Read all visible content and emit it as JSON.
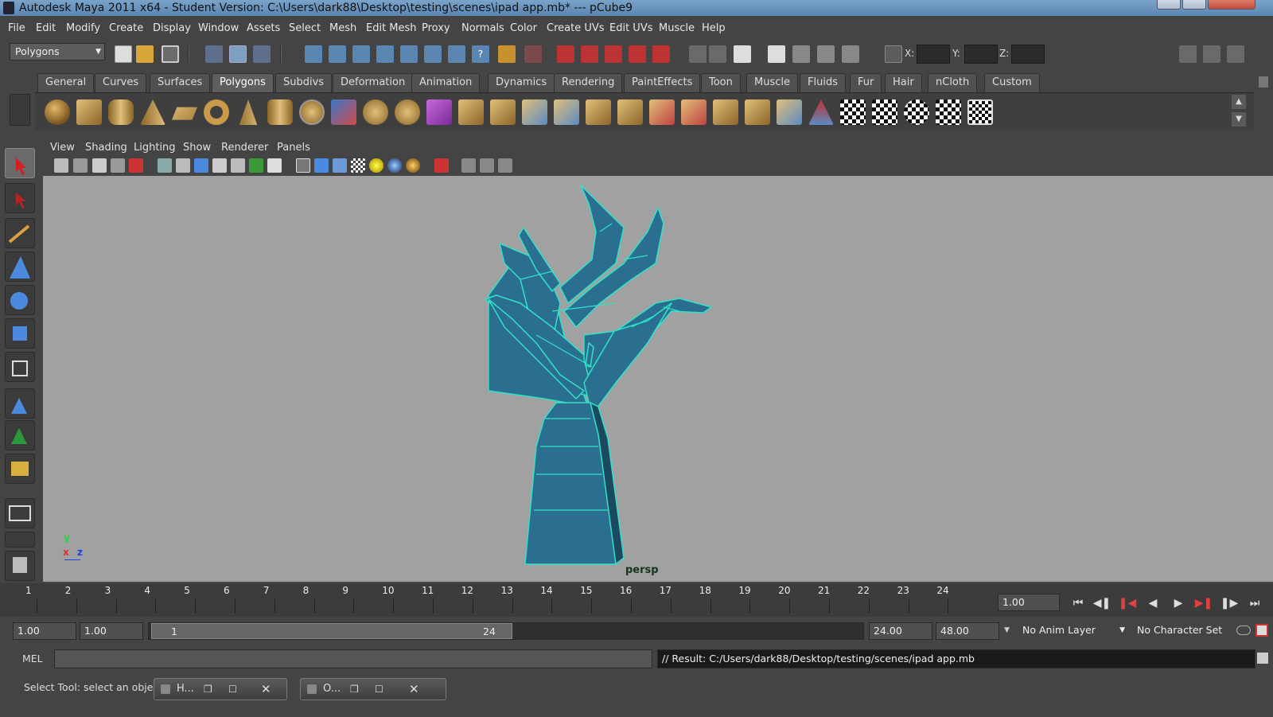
{
  "window": {
    "title": "Autodesk Maya 2011 x64 - Student Version: C:\\Users\\dark88\\Desktop\\testing\\scenes\\ipad app.mb*  ---  pCube9"
  },
  "menubar": [
    "File",
    "Edit",
    "Modify",
    "Create",
    "Display",
    "Window",
    "Assets",
    "Select",
    "Mesh",
    "Edit Mesh",
    "Proxy",
    "Normals",
    "Color",
    "Create UVs",
    "Edit UVs",
    "Muscle",
    "Help"
  ],
  "statusline": {
    "menu_set": "Polygons",
    "x_label": "X:",
    "y_label": "Y:",
    "z_label": "Z:"
  },
  "shelf": {
    "tabs": [
      "General",
      "Curves",
      "Surfaces",
      "Polygons",
      "Subdivs",
      "Deformation",
      "Animation",
      "Dynamics",
      "Rendering",
      "PaintEffects",
      "Toon",
      "Muscle",
      "Fluids",
      "Fur",
      "Hair",
      "nCloth",
      "Custom"
    ],
    "active_tab": "Polygons"
  },
  "panel_menu": [
    "View",
    "Shading",
    "Lighting",
    "Show",
    "Renderer",
    "Panels"
  ],
  "viewport": {
    "camera_label": "persp",
    "axis_y": "y",
    "axis_x": "x",
    "axis_z": "z",
    "colors": {
      "background": "#a1a1a1",
      "mesh_fill": "#2a6f8f",
      "mesh_wire": "#33e0c8"
    }
  },
  "timeline": {
    "frames": [
      "1",
      "2",
      "3",
      "4",
      "5",
      "6",
      "7",
      "8",
      "9",
      "10",
      "11",
      "12",
      "13",
      "14",
      "15",
      "16",
      "17",
      "18",
      "19",
      "20",
      "21",
      "22",
      "23",
      "24"
    ],
    "current_time": "1.00"
  },
  "range": {
    "start": "1.00",
    "playback_start": "1.00",
    "slider_min": "1",
    "slider_max": "24",
    "playback_end": "24.00",
    "end": "48.00",
    "anim_layer": "No Anim Layer",
    "character_set": "No Character Set"
  },
  "command_line": {
    "label": "MEL",
    "result": "// Result: C:/Users/dark88/Desktop/testing/scenes/ipad app.mb"
  },
  "help_line": {
    "text": "Select Tool: select an object",
    "task1": "H...",
    "task2": "O..."
  }
}
